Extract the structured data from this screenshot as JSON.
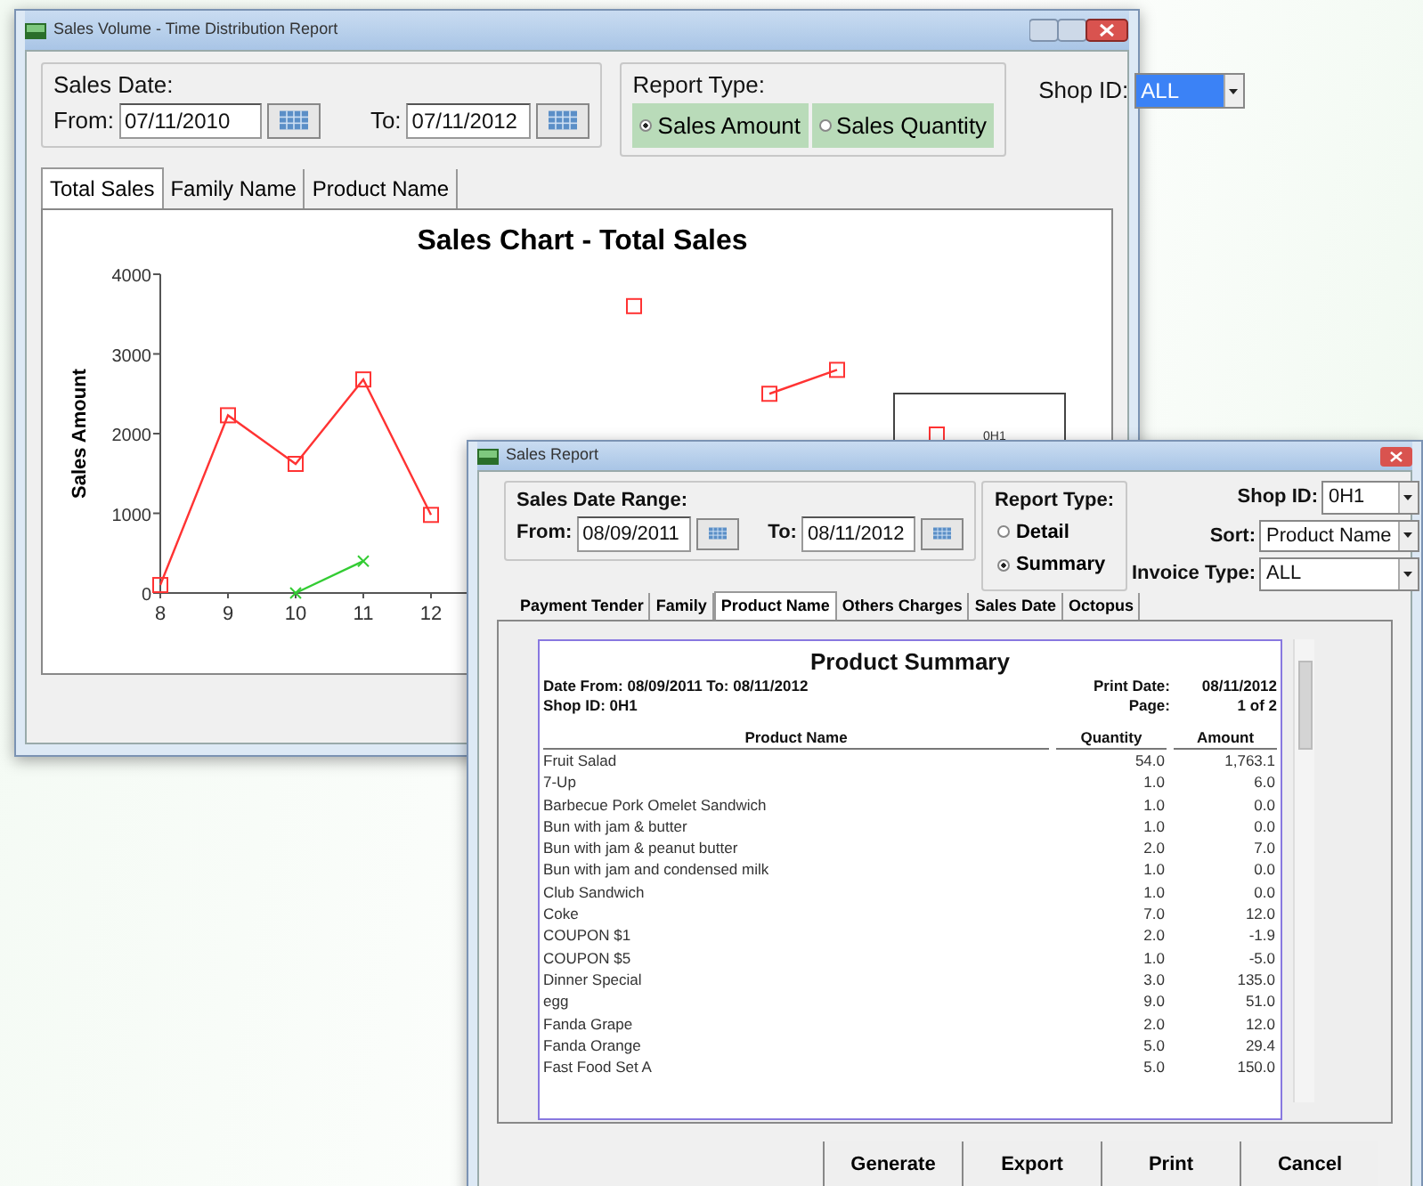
{
  "main_window": {
    "title": "Sales Volume - Time Distribution Report",
    "sales_date": {
      "label": "Sales Date:",
      "from_label": "From:",
      "from_value": "07/11/2010",
      "to_label": "To:",
      "to_value": "07/11/2012"
    },
    "report_type": {
      "label": "Report Type:",
      "options": [
        {
          "label": "Sales Amount",
          "selected": true
        },
        {
          "label": "Sales Quantity",
          "selected": false
        }
      ]
    },
    "shop_id": {
      "label": "Shop ID:",
      "value": "ALL"
    },
    "tabs": [
      {
        "label": "Total Sales",
        "selected": true
      },
      {
        "label": "Family Name",
        "selected": false
      },
      {
        "label": "Product Name",
        "selected": false
      }
    ],
    "chart": {
      "chart_data": {
        "type": "line",
        "title": "Sales Chart - Total Sales",
        "ylabel": "Sales Amount",
        "x": [
          8,
          9,
          10,
          11,
          12,
          13,
          14,
          15,
          16,
          17,
          18
        ],
        "xlim": [
          8,
          18
        ],
        "xticks": [
          8,
          9,
          10,
          11,
          12
        ],
        "yticks": [
          0,
          1000,
          2000,
          3000,
          4000
        ],
        "ylim": [
          0,
          4000
        ],
        "series": [
          {
            "name": "0H1",
            "color": "#ff3333",
            "marker": "square",
            "values": [
              100,
              2230,
              1620,
              2680,
              980,
              null,
              null,
              3600,
              null,
              2500,
              2800
            ]
          },
          {
            "color": "#33cc33",
            "marker": "cross",
            "values": [
              null,
              null,
              0,
              400,
              null,
              null,
              null,
              null,
              null,
              null,
              null
            ]
          }
        ]
      }
    }
  },
  "report_window": {
    "title": "Sales Report",
    "date_range": {
      "label": "Sales Date Range:",
      "from_label": "From:",
      "from_value": "08/09/2011",
      "to_label": "To:",
      "to_value": "08/11/2012"
    },
    "report_type": {
      "label": "Report Type:",
      "options": [
        {
          "label": "Detail",
          "selected": false
        },
        {
          "label": "Summary",
          "selected": true
        }
      ]
    },
    "filters": [
      {
        "label": "Shop ID:",
        "value": "0H1"
      },
      {
        "label": "Sort:",
        "value": "Product Name"
      },
      {
        "label": "Invoice Type:",
        "value": "ALL"
      }
    ],
    "tabs": [
      {
        "label": "Payment Tender",
        "selected": false
      },
      {
        "label": "Family",
        "selected": false
      },
      {
        "label": "Product Name",
        "selected": true
      },
      {
        "label": "Others Charges",
        "selected": false
      },
      {
        "label": "Sales Date",
        "selected": false
      },
      {
        "label": "Octopus",
        "selected": false
      }
    ],
    "report": {
      "title": "Product Summary",
      "date_line": "Date From: 08/09/2011 To: 08/11/2012",
      "shop_line": "Shop ID: 0H1",
      "print_date_label": "Print Date:",
      "print_date": "08/11/2012",
      "page_label": "Page:",
      "page": "1 of 2",
      "columns": [
        "Product Name",
        "Quantity",
        "Amount"
      ],
      "rows": [
        [
          "Fruit Salad",
          "54.0",
          "1,763.1"
        ],
        [
          "7-Up",
          "1.0",
          "6.0"
        ],
        [
          "Barbecue Pork Omelet Sandwich",
          "1.0",
          "0.0"
        ],
        [
          "Bun with jam & butter",
          "1.0",
          "0.0"
        ],
        [
          "Bun with jam & peanut butter",
          "2.0",
          "7.0"
        ],
        [
          "Bun with jam and condensed milk",
          "1.0",
          "0.0"
        ],
        [
          "Club Sandwich",
          "1.0",
          "0.0"
        ],
        [
          "Coke",
          "7.0",
          "12.0"
        ],
        [
          "COUPON $1",
          "2.0",
          "-1.9"
        ],
        [
          "COUPON $5",
          "1.0",
          "-5.0"
        ],
        [
          "Dinner Special",
          "3.0",
          "135.0"
        ],
        [
          "egg",
          "9.0",
          "51.0"
        ],
        [
          "Fanda Grape",
          "2.0",
          "12.0"
        ],
        [
          "Fanda Orange",
          "5.0",
          "29.4"
        ],
        [
          "Fast Food Set A",
          "5.0",
          "150.0"
        ]
      ]
    },
    "buttons": [
      "Generate",
      "Export",
      "Print",
      "Cancel"
    ]
  }
}
